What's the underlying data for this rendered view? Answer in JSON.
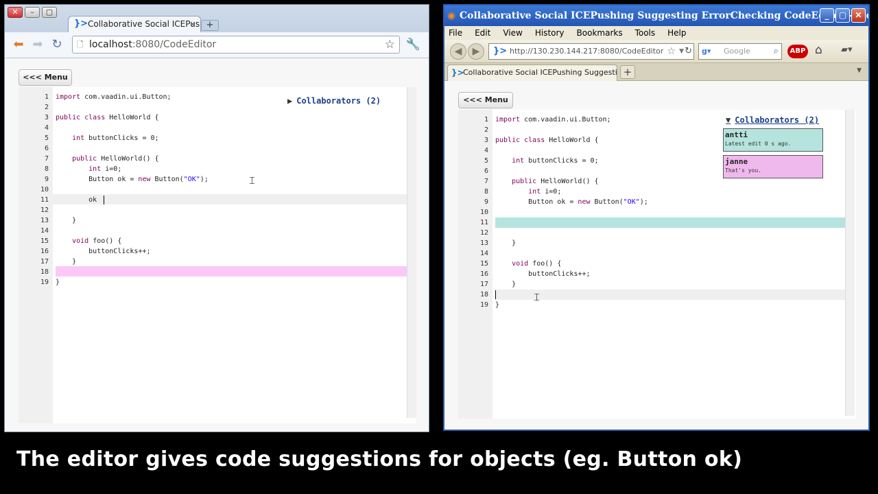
{
  "chrome": {
    "tab_title": "Collaborative Social ICEPus",
    "tab_close": "×",
    "new_tab": "+",
    "url_host": "localhost",
    "url_path": ":8080/CodeEditor",
    "window_buttons": [
      "✕",
      "–",
      "▢"
    ]
  },
  "firefox": {
    "window_title": "Collaborative Social ICEPushing Suggesting ErrorChecking CodeEditor - Mozilla Fir...",
    "menus": [
      "File",
      "Edit",
      "View",
      "History",
      "Bookmarks",
      "Tools",
      "Help"
    ],
    "url": "http://130.230.144.217:8080/CodeEditor",
    "search_placeholder": "Google",
    "tab_title": "Collaborative Social ICEPushing Suggesting ...",
    "new_tab": "+",
    "abp_label": "ABP"
  },
  "editor_left": {
    "menu_label": "<<< Menu",
    "collaborators_label": "Collaborators (2)",
    "collapsed": true,
    "typed_text": "ok"
  },
  "editor_right": {
    "menu_label": "<<< Menu",
    "collaborators_label": "Collaborators (2)",
    "collapsed": false,
    "collaborators": [
      {
        "name": "antti",
        "status": "Latest edit 0 s ago.",
        "color": "#b5e3dd"
      },
      {
        "name": "janne",
        "status": "That's you.",
        "color": "#f0b9ed"
      }
    ]
  },
  "code_lines": [
    [
      {
        "t": "import",
        "c": "kw"
      },
      {
        "t": " com.vaadin.ui.Button;"
      }
    ],
    [],
    [
      {
        "t": "public class",
        "c": "kw"
      },
      {
        "t": " HelloWorld {"
      }
    ],
    [],
    [
      {
        "t": "    int",
        "c": "kw"
      },
      {
        "t": " buttonClicks = 0;"
      }
    ],
    [],
    [
      {
        "t": "    public",
        "c": "kw"
      },
      {
        "t": " HelloWorld() {"
      }
    ],
    [
      {
        "t": "        int",
        "c": "kw"
      },
      {
        "t": " i=0;"
      }
    ],
    [
      {
        "t": "        Button ok = "
      },
      {
        "t": "new",
        "c": "kw"
      },
      {
        "t": " Button("
      },
      {
        "t": "\"OK\"",
        "c": "str"
      },
      {
        "t": ");"
      }
    ],
    [],
    [],
    [],
    [
      {
        "t": "    }"
      }
    ],
    [],
    [
      {
        "t": "    void",
        "c": "kw"
      },
      {
        "t": " foo() {"
      }
    ],
    [
      {
        "t": "        buttonClicks++;"
      }
    ],
    [
      {
        "t": "    }"
      }
    ],
    [],
    [
      {
        "t": "}"
      }
    ]
  ],
  "caption": "The editor gives code suggestions for objects (eg. Button ok)",
  "colors": {
    "highlight_pink": "#fcc8f7",
    "highlight_teal": "#b5e3dd",
    "keyword": "#7f0055",
    "string": "#2a00ff"
  }
}
